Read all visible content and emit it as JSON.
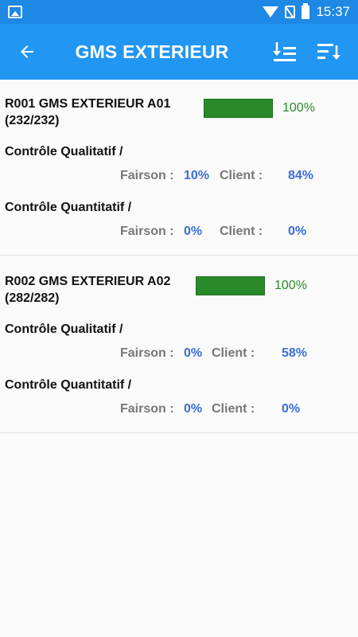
{
  "status_bar": {
    "time": "15:37"
  },
  "app_bar": {
    "title": "GMS EXTERIEUR"
  },
  "items": [
    {
      "name_line1": "R001 GMS EXTERIEUR A01",
      "name_line2": "(232/232)",
      "progress": 1.0,
      "progress_text": "100%",
      "qual_label": "Contrôle Qualitatif /",
      "qual_fairson_label": "Fairson :",
      "qual_fairson_value": "10%",
      "qual_client_label": "Client :",
      "qual_client_value": "84%",
      "quant_label": "Contrôle Quantitatif /",
      "quant_fairson_label": "Fairson :",
      "quant_fairson_value": "0%",
      "quant_client_label": "Client :",
      "quant_client_value": "0%"
    },
    {
      "name_line1": "R002 GMS EXTERIEUR A02",
      "name_line2": "(282/282)",
      "progress": 1.0,
      "progress_text": "100%",
      "qual_label": "Contrôle Qualitatif /",
      "qual_fairson_label": "Fairson :",
      "qual_fairson_value": "0%",
      "qual_client_label": "Client :",
      "qual_client_value": "58%",
      "quant_label": "Contrôle Quantitatif /",
      "quant_fairson_label": "Fairson :",
      "quant_fairson_value": "0%",
      "quant_client_label": "Client :",
      "quant_client_value": "0%"
    }
  ],
  "icons": {
    "status_left": "image-notification-icon",
    "wifi": "wifi-icon",
    "sim": "no-sim-icon",
    "battery": "battery-icon",
    "back": "arrow-back-icon",
    "sort1": "sort-list-icon",
    "sort2": "sort-descending-icon"
  },
  "colors": {
    "status_bar": "#1e88e5",
    "app_bar": "#2196f3",
    "progress": "#2a8a2a",
    "value_blue": "#3a6fd8"
  }
}
